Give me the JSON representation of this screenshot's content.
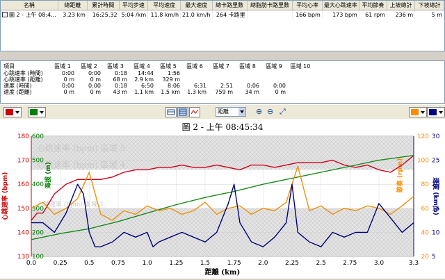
{
  "summary": {
    "columns": [
      "名稱",
      "總距離",
      "累計時間",
      "平均步速",
      "平均速度",
      "最大速度",
      "總卡路里數",
      "總脂肪卡路里數",
      "平均心率",
      "最大心跳速率",
      "平均節奏",
      "上坡總計",
      "下坡總計"
    ],
    "row": [
      "圖 2 - 上午 08:4...",
      "3.23 km",
      "16:25.32",
      "5:04 /km",
      "11.8 km/h",
      "21.0 km/h",
      "264 卡路里",
      "",
      "166 bpm",
      "173 bpm",
      "61 rpm",
      "236 m",
      "5 m"
    ]
  },
  "zones": {
    "columns": [
      "項目",
      "區域 1",
      "區域 2",
      "區域 3",
      "區域 4",
      "區域 5",
      "區域 6",
      "區域 7",
      "區域 8",
      "區域 9",
      "區域 10"
    ],
    "rows": [
      [
        "心跳速率 (時間)",
        "0:00",
        "0:00",
        "0:18",
        "14:44",
        "1:56",
        "",
        "",
        "",
        "",
        ""
      ],
      [
        "心跳速率 (距離)",
        "0 m",
        "0 m",
        "68 m",
        "2.9 km",
        "329 m",
        "",
        "",
        "",
        "",
        ""
      ],
      [
        "速度 (時間)",
        "0:00",
        "0:00",
        "0:18",
        "6:50",
        "8:06",
        "6:31",
        "2:51",
        "0:06",
        "0:00",
        ""
      ],
      [
        "速度 (距離)",
        "0 m",
        "0 m",
        "43 m",
        "1.1 km",
        "1.5 km",
        "1.3 km",
        "759 m",
        "34 m",
        "0 m",
        ""
      ]
    ]
  },
  "toolbar": {
    "color_left_1": "#cc0000",
    "color_left_2": "#008000",
    "color_right_1": "#ff8c00",
    "color_right_2": "#000080",
    "axis_select": "距離"
  },
  "chart_data": {
    "type": "line",
    "title": "圖 2 - 上午 08:45:34",
    "xlabel": "距離 (km)",
    "xlim": [
      0,
      3.3
    ],
    "xticks": [
      "0.0",
      "0.25",
      "0.5",
      "0.75",
      "1.0",
      "1.25",
      "1.5",
      "1.75",
      "2.0",
      "2.25",
      "2.5",
      "2.75",
      "3.0",
      "3.3"
    ],
    "axes": {
      "hr": {
        "label": "心跳速率 (bpm)",
        "ylim": [
          130,
          180
        ],
        "ticks": [
          "130",
          "140",
          "150",
          "160",
          "170",
          "180"
        ],
        "color": "#cc0000"
      },
      "elev": {
        "label": "海拔 (m)",
        "ylim": [
          100,
          600
        ],
        "ticks": [
          "100",
          "200",
          "300",
          "400",
          "500",
          "600"
        ],
        "color": "#008000"
      },
      "cad": {
        "label": "節奏 (rpm)",
        "ylim": [
          20,
          120
        ],
        "ticks": [
          "20",
          "40",
          "60",
          "80",
          "100",
          "120"
        ],
        "color": "#ff8c00"
      },
      "speed": {
        "label": "速度 (km/h)",
        "ylim": [
          5,
          30
        ],
        "ticks": [
          "5",
          "10",
          "15",
          "20",
          "25",
          "30"
        ],
        "color": "#000080"
      }
    },
    "zone_labels": [
      "心跳速率 (bpm) 區域 5",
      "心跳速率 (bpm) 區域 4",
      "心跳速率 (bpm) 區域 3"
    ],
    "series": [
      {
        "axis": "hr",
        "color": "#d0021b",
        "x": [
          0,
          0.05,
          0.1,
          0.15,
          0.2,
          0.25,
          0.3,
          0.35,
          0.4,
          0.5,
          0.6,
          0.7,
          0.8,
          0.9,
          1.0,
          1.1,
          1.2,
          1.3,
          1.4,
          1.5,
          1.6,
          1.7,
          1.8,
          1.9,
          2.0,
          2.1,
          2.2,
          2.3,
          2.4,
          2.5,
          2.6,
          2.7,
          2.8,
          2.9,
          3.0,
          3.1,
          3.2,
          3.3
        ],
        "values": [
          145,
          148,
          148,
          152,
          156,
          158,
          160,
          161,
          162,
          162,
          162,
          163,
          165,
          166,
          166,
          167,
          167,
          168,
          167,
          167,
          168,
          167,
          166,
          168,
          168,
          167,
          168,
          169,
          169,
          169,
          170,
          168,
          167,
          168,
          166,
          165,
          168,
          172
        ]
      },
      {
        "axis": "elev",
        "color": "#1a8a1a",
        "x": [
          0,
          0.25,
          0.5,
          0.75,
          1.0,
          1.25,
          1.5,
          1.75,
          2.0,
          2.25,
          2.5,
          2.75,
          3.0,
          3.3
        ],
        "values": [
          170,
          195,
          215,
          245,
          280,
          315,
          345,
          370,
          400,
          425,
          450,
          475,
          500,
          520
        ]
      },
      {
        "axis": "cad",
        "color": "#f0900a",
        "x": [
          0,
          0.1,
          0.2,
          0.3,
          0.4,
          0.5,
          0.6,
          0.7,
          0.8,
          0.9,
          1.0,
          1.1,
          1.2,
          1.3,
          1.4,
          1.5,
          1.6,
          1.7,
          1.8,
          1.9,
          2.0,
          2.1,
          2.2,
          2.3,
          2.4,
          2.5,
          2.6,
          2.7,
          2.8,
          2.9,
          3.0,
          3.1,
          3.2,
          3.3
        ],
        "values": [
          60,
          65,
          55,
          60,
          68,
          90,
          55,
          50,
          58,
          55,
          62,
          58,
          60,
          55,
          58,
          65,
          55,
          60,
          62,
          55,
          60,
          58,
          65,
          95,
          58,
          62,
          55,
          60,
          58,
          62,
          60,
          55,
          62,
          70
        ]
      },
      {
        "axis": "speed",
        "color": "#00007a",
        "x": [
          0,
          0.1,
          0.2,
          0.3,
          0.35,
          0.4,
          0.45,
          0.5,
          0.55,
          0.6,
          0.7,
          0.8,
          0.9,
          1.0,
          1.05,
          1.1,
          1.2,
          1.3,
          1.4,
          1.5,
          1.6,
          1.7,
          1.75,
          1.8,
          1.9,
          2.0,
          2.1,
          2.2,
          2.25,
          2.3,
          2.4,
          2.5,
          2.6,
          2.7,
          2.8,
          2.9,
          3.0,
          3.1,
          3.2,
          3.3
        ],
        "values": [
          12,
          12,
          10,
          14,
          17,
          20,
          18,
          10,
          7,
          7,
          8,
          10,
          9,
          10,
          7,
          8,
          9,
          10,
          9,
          8,
          10,
          16,
          20,
          12,
          8,
          7,
          9,
          12,
          20,
          10,
          8,
          7,
          10,
          9,
          10,
          10,
          16,
          13,
          10,
          12
        ]
      }
    ]
  }
}
